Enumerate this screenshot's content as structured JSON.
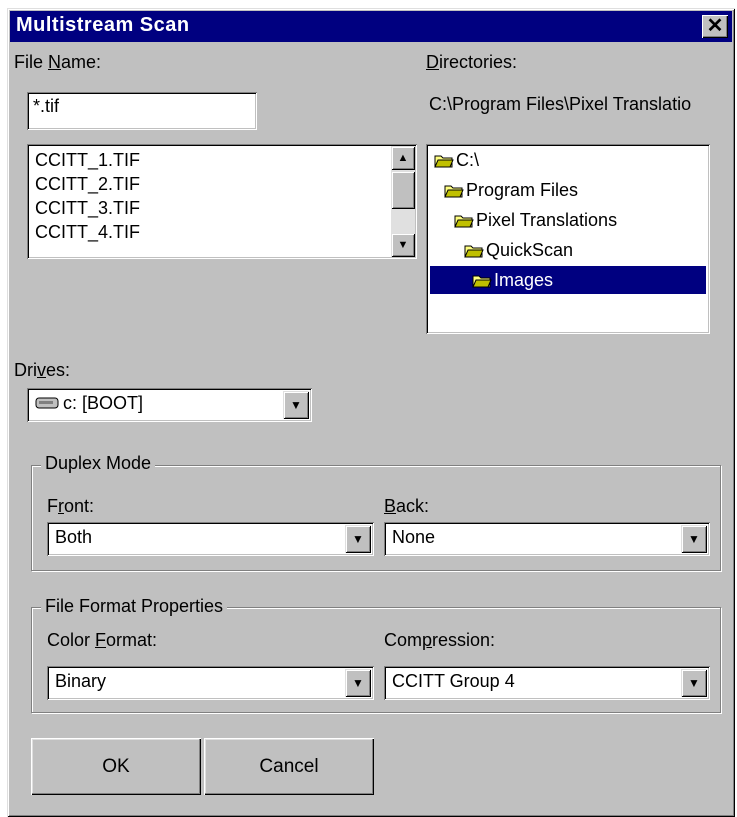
{
  "window": {
    "title": "Multistream Scan",
    "close_glyph": "✕"
  },
  "file_name": {
    "label_pre": "File ",
    "label_key": "N",
    "label_post": "ame:",
    "value": "*.tif"
  },
  "files": [
    "CCITT_1.TIF",
    "CCITT_2.TIF",
    "CCITT_3.TIF",
    "CCITT_4.TIF"
  ],
  "directories": {
    "label_key": "D",
    "label_post": "irectories:",
    "current_path": "C:\\Program Files\\Pixel Translatio",
    "tree": [
      "C:\\",
      "Program Files",
      "Pixel Translations",
      "QuickScan",
      "Images"
    ],
    "selected_index": 4
  },
  "drives": {
    "label_pre": "Dri",
    "label_key": "v",
    "label_post": "es:",
    "value": "c: [BOOT]",
    "icon": "drive-icon"
  },
  "duplex": {
    "legend": "Duplex Mode",
    "front_label_pre": "F",
    "front_label_key": "r",
    "front_label_post": "ont:",
    "front_value": "Both",
    "back_label_key": "B",
    "back_label_post": "ack:",
    "back_value": "None"
  },
  "file_format": {
    "legend": "File Format Properties",
    "color_label_pre": "Color ",
    "color_label_key": "F",
    "color_label_post": "ormat:",
    "color_value": "Binary",
    "compression_label_pre": "Com",
    "compression_label_key": "p",
    "compression_label_post": "ression:",
    "compression_value": "CCITT Group 4"
  },
  "buttons": {
    "ok": "OK",
    "cancel": "Cancel"
  },
  "colors": {
    "titlebar": "#000080",
    "face": "#c0c0c0",
    "selection": "#000080"
  }
}
